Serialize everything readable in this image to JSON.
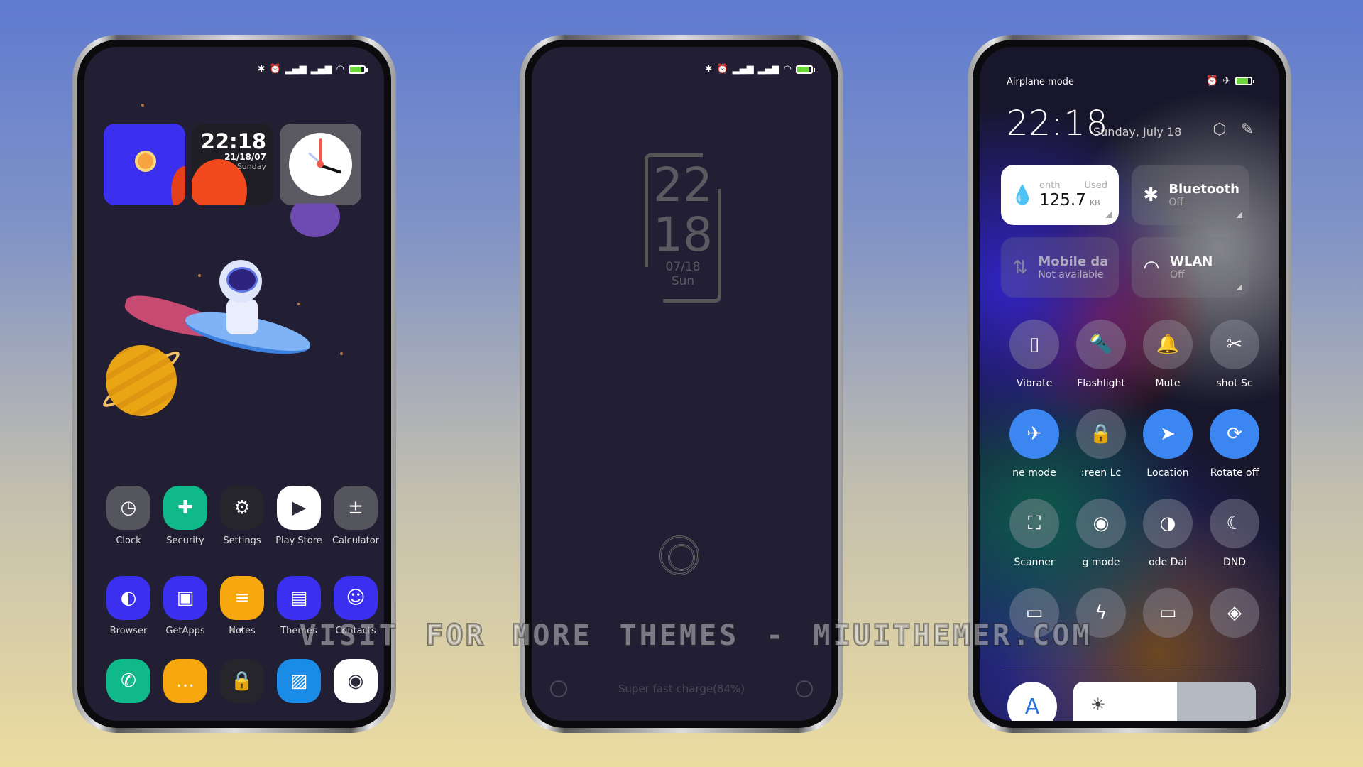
{
  "phones": {
    "home": {
      "status_icons": [
        "bluetooth-icon",
        "alarm-icon",
        "signal-hd-icon",
        "signal-hd-icon",
        "wifi-icon",
        "battery-charging-icon"
      ],
      "widget_time": "22:18",
      "widget_date": "21/18/07",
      "widget_day": "Sunday",
      "apps_row1": [
        {
          "label": "Clock",
          "icon": "clock-icon",
          "color": "#55555e",
          "glyph": "◷"
        },
        {
          "label": "Security",
          "icon": "shield-icon",
          "color": "#10b98a",
          "glyph": "✚"
        },
        {
          "label": "Settings",
          "icon": "gear-icon",
          "color": "#25252b",
          "glyph": "⚙"
        },
        {
          "label": "Play Store",
          "icon": "play-store-icon",
          "color": "#ffffff",
          "glyph": "▶"
        },
        {
          "label": "Calculator",
          "icon": "calculator-icon",
          "color": "#55555e",
          "glyph": "±"
        }
      ],
      "apps_row2": [
        {
          "label": "Browser",
          "icon": "browser-icon",
          "color": "#3b2ff0",
          "glyph": "◐"
        },
        {
          "label": "GetApps",
          "icon": "getapps-icon",
          "color": "#3b2ff0",
          "glyph": "▣"
        },
        {
          "label": "Notes",
          "icon": "notes-icon",
          "color": "#f8a80f",
          "glyph": "≡"
        },
        {
          "label": "Themes",
          "icon": "themes-icon",
          "color": "#3b2ff0",
          "glyph": "▤"
        },
        {
          "label": "Contacts",
          "icon": "contacts-icon",
          "color": "#3b2ff0",
          "glyph": "☺"
        }
      ],
      "dock": [
        {
          "icon": "phone-icon",
          "color": "#10b98a",
          "glyph": "✆"
        },
        {
          "icon": "messages-icon",
          "color": "#f8a80f",
          "glyph": "…"
        },
        {
          "icon": "app-lock-icon",
          "color": "#25252b",
          "glyph": "🔒"
        },
        {
          "icon": "gallery-icon",
          "color": "#1a8ce8",
          "glyph": "▨"
        },
        {
          "icon": "camera-icon",
          "color": "#ffffff",
          "glyph": "◉"
        }
      ],
      "page_indicator": {
        "pages": 2,
        "current": 2
      }
    },
    "lock": {
      "status_icons": [
        "bluetooth-icon",
        "alarm-icon",
        "signal-hd-icon",
        "signal-hd-icon",
        "wifi-icon",
        "battery-charging-icon"
      ],
      "hour": "22",
      "minute": "18",
      "date": "07/18",
      "day": "Sun",
      "charge_text": "Super fast charge(84%)"
    },
    "control_center": {
      "mode_text": "Airplane mode",
      "status_icons": [
        "alarm-icon",
        "airplane-icon",
        "battery-charging-icon"
      ],
      "time": "22:18",
      "date": "Sunday, July 18",
      "data_tile": {
        "label_left": "onth",
        "label_right": "Used",
        "value": "125.7",
        "unit": "KB"
      },
      "bluetooth_tile": {
        "title": "Bluetooth",
        "status": "Off"
      },
      "mobile_tile": {
        "title": "Mobile dat",
        "status": "Not available"
      },
      "wlan_tile": {
        "title": "WLAN",
        "status": "Off"
      },
      "toggles": [
        {
          "label": "Vibrate",
          "icon": "vibrate-icon",
          "glyph": "▯",
          "on": false
        },
        {
          "label": "Flashlight",
          "icon": "flashlight-icon",
          "glyph": "🔦",
          "on": false
        },
        {
          "label": "Mute",
          "icon": "bell-icon",
          "glyph": "🔔",
          "on": false
        },
        {
          "label": "shot    Sc",
          "icon": "screenshot-icon",
          "glyph": "✂",
          "on": false
        },
        {
          "label": "ne mode",
          "icon": "airplane-icon",
          "glyph": "✈",
          "on": true
        },
        {
          "label": ":reen    Lc",
          "icon": "lock-screen-icon",
          "glyph": "🔒",
          "on": false
        },
        {
          "label": "Location",
          "icon": "location-icon",
          "glyph": "➤",
          "on": true
        },
        {
          "label": "Rotate off",
          "icon": "rotate-lock-icon",
          "glyph": "⟳",
          "on": true
        },
        {
          "label": "Scanner",
          "icon": "scanner-icon",
          "glyph": "⛶",
          "on": false
        },
        {
          "label": "g mode",
          "icon": "eye-icon",
          "glyph": "◉",
          "on": false
        },
        {
          "label": "ode    Dai",
          "icon": "dark-mode-icon",
          "glyph": "◑",
          "on": false
        },
        {
          "label": "DND",
          "icon": "moon-icon",
          "glyph": "☾",
          "on": false
        },
        {
          "label": "",
          "icon": "battery-saver-icon",
          "glyph": "▭",
          "on": false
        },
        {
          "label": "",
          "icon": "power-icon",
          "glyph": "ϟ",
          "on": false
        },
        {
          "label": "",
          "icon": "cast-icon",
          "glyph": "▭",
          "on": false
        },
        {
          "label": "",
          "icon": "mi-share-icon",
          "glyph": "◈",
          "on": false
        }
      ],
      "auto_brightness_label": "A",
      "brightness": 0.57
    }
  },
  "watermark": "VISIT FOR MORE THEMES - MIUITHEMER.COM"
}
